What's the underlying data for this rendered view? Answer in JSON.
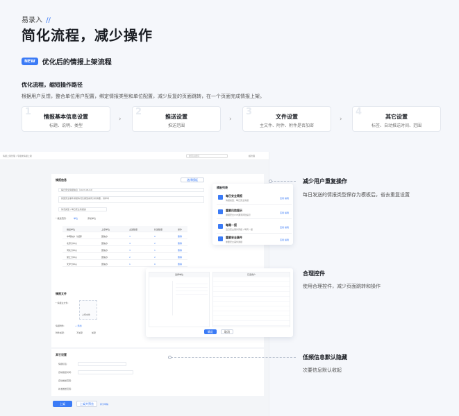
{
  "header": {
    "eyebrow": "易录入",
    "eyebrow_mark": "//",
    "title": "简化流程，减少操作"
  },
  "badge": {
    "label": "NEW",
    "title": "优化后的情报上架流程"
  },
  "section": {
    "title": "优化流程，缩短操作路径",
    "desc": "根据用户反馈，整合单位用户配置，绑定情报类型和单位配置，减少反复的页面跳转，在一个页面完成情报上架。"
  },
  "steps": [
    {
      "num": "1",
      "title": "情报基本信息设置",
      "desc": "标题、说明、类型"
    },
    {
      "num": "2",
      "title": "推送设置",
      "desc": "推送范围"
    },
    {
      "num": "3",
      "title": "文件设置",
      "desc": "主文件、附件、附件是否加密"
    },
    {
      "num": "4",
      "title": "其它设置",
      "desc": "标签、自动推送时间、范围"
    }
  ],
  "callouts": [
    {
      "title": "减少用户重复操作",
      "desc": "每日发送的情报类型保存为模板后，省去重复设置"
    },
    {
      "title": "合理控件",
      "desc": "使用合理控件，减少页面跳转和操作"
    },
    {
      "title": "低频信息默认隐藏",
      "desc": "次要信息默认收起"
    }
  ],
  "mock": {
    "breadcrumb": "情报上架管理 / 专报类情报上架",
    "search": "搜索关键词",
    "user": "超管理",
    "info_title": "情报信息",
    "save_tpl": "选择模板",
    "field_title": "每日安全简报信息（2023.08.02）",
    "field_desc": "我国安全事件通报情况及典型案例分析摘要，供参考",
    "field_type": "情况类型 / 每日安全简报类",
    "push_label": "* 推送范围:",
    "push_opt1": "单位",
    "push_opt2": "添加单位",
    "table_headers": [
      "推送单位",
      "上级单位",
      "主送数量",
      "抄送数量",
      "操作"
    ],
    "table_rows": [
      [
        "中网信办（总部）",
        "国信办",
        "3",
        "0",
        "删除"
      ],
      [
        "北京分中心",
        "国信办",
        "4",
        "2",
        "删除"
      ],
      [
        "河北分中心",
        "国信办",
        "3",
        "1",
        "删除"
      ],
      [
        "浙江分中心",
        "国信办",
        "2",
        "2",
        "删除"
      ],
      [
        "天津分中心",
        "国信办",
        "1",
        "0",
        "删除"
      ]
    ],
    "file_title": "情报文件",
    "file_main": "* 情报主文件:",
    "file_upload": "上传文件",
    "attach_label": "情报附件:",
    "attach_add": "+ 添加",
    "encrypt_label": "附件加密:",
    "encrypt_yes": "不加密",
    "encrypt_no": "加密",
    "other_title": "其它设置",
    "tag_label": "情报标签:",
    "auto_time": "自动推送时间:",
    "auto_scope1": "自动推送范围:",
    "auto_scope2": "补发推送范围:",
    "btn_submit": "上架",
    "btn_preview": "上架并预览",
    "btn_draft": "存为草稿",
    "tpl_title": "模板列表",
    "tpl_items": [
      {
        "t": "每日安全简报",
        "s": "情报类型：每日安全简报"
      },
      {
        "t": "重要风险提示",
        "s": "通报安全CVE漏洞风险提示"
      },
      {
        "t": "每周一报",
        "s": "近日安全事件周报 / 每周一报"
      },
      {
        "t": "重要安全事件",
        "s": "重要安全事件通报"
      }
    ],
    "tpl_apply": "应用",
    "tpl_edit": "编辑",
    "sel_left_title": "选择单位",
    "sel_right_title": "已选用户",
    "sel_ok": "确定",
    "sel_cancel": "取消"
  }
}
